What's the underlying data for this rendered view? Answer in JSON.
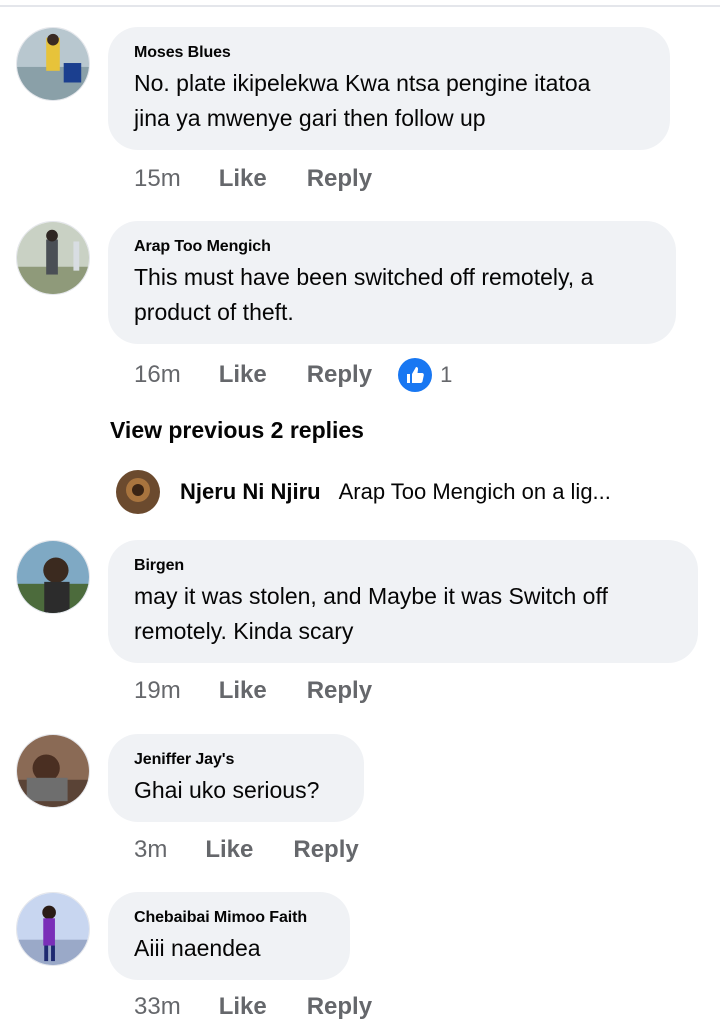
{
  "comments": [
    {
      "name": "Moses Blues",
      "line1": "No. plate ikipelekwa Kwa ntsa pengine itatoa",
      "line2": "jina ya mwenye gari then follow up",
      "time": "15m",
      "like": "Like",
      "reply": "Reply"
    },
    {
      "name": "Arap Too Mengich",
      "line1": "This must have been switched off remotely, a",
      "line2": "product of theft.",
      "time": "16m",
      "like": "Like",
      "reply": "Reply",
      "reactions": "1"
    },
    {
      "name": "Birgen",
      "line1": "may it was stolen,  and Maybe it was Switch off",
      "line2": "remotely. Kinda scary",
      "time": "19m",
      "like": "Like",
      "reply": "Reply"
    },
    {
      "name": "Jeniffer Jay's",
      "line1": "Ghai uko serious?",
      "time": "3m",
      "like": "Like",
      "reply": "Reply"
    },
    {
      "name": "Chebaibai Mimoo Faith",
      "line1": "Aiii naendea",
      "time": "33m",
      "like": "Like",
      "reply": "Reply"
    }
  ],
  "view_previous": "View previous 2 replies",
  "reply_preview": {
    "name": "Njeru Ni Njiru",
    "text": "Arap Too Mengich on a lig..."
  },
  "colors": {
    "bubble": "#f0f2f5",
    "muted": "#65676b",
    "like_blue": "#1877f2"
  }
}
